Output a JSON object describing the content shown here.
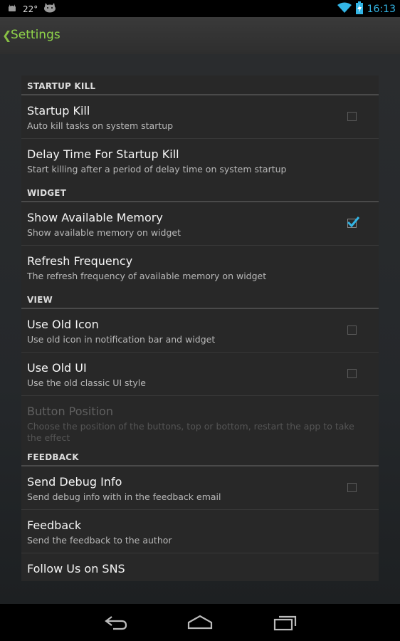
{
  "statusbar": {
    "temperature": "22°",
    "time": "16:13",
    "icons": [
      "android-icon",
      "cat-icon",
      "wifi-icon",
      "battery-charging-icon"
    ]
  },
  "actionbar": {
    "back_glyph": "❮",
    "title": "Settings",
    "accent_color": "#8fd34a"
  },
  "categories": [
    {
      "header": "STARTUP KILL",
      "items": [
        {
          "title": "Startup Kill",
          "summary": "Auto kill tasks on system startup",
          "checkbox": true,
          "checked": false
        },
        {
          "title": "Delay Time For Startup Kill",
          "summary": "Start killing after a period of delay time on system startup",
          "checkbox": false
        }
      ]
    },
    {
      "header": "WIDGET",
      "items": [
        {
          "title": "Show Available Memory",
          "summary": "Show available memory on widget",
          "checkbox": true,
          "checked": true
        },
        {
          "title": "Refresh Frequency",
          "summary": "The refresh frequency of available memory on widget",
          "checkbox": false
        }
      ]
    },
    {
      "header": "VIEW",
      "items": [
        {
          "title": "Use Old Icon",
          "summary": "Use old icon in notification bar and widget",
          "checkbox": true,
          "checked": false
        },
        {
          "title": "Use Old UI",
          "summary": "Use the old classic UI style",
          "checkbox": true,
          "checked": false
        },
        {
          "title": "Button Position",
          "summary": "Choose the position of the buttons, top or bottom, restart the app to take the effect",
          "checkbox": false,
          "disabled": true
        }
      ]
    },
    {
      "header": "FEEDBACK",
      "items": [
        {
          "title": "Send Debug Info",
          "summary": "Send debug info with in the feedback email",
          "checkbox": true,
          "checked": false
        },
        {
          "title": "Feedback",
          "summary": "Send the feedback to the author",
          "checkbox": false
        },
        {
          "title": "Follow Us on SNS",
          "summary": "",
          "checkbox": false
        }
      ]
    }
  ],
  "navbar": {
    "buttons": [
      "back-icon",
      "home-icon",
      "recents-icon"
    ]
  }
}
